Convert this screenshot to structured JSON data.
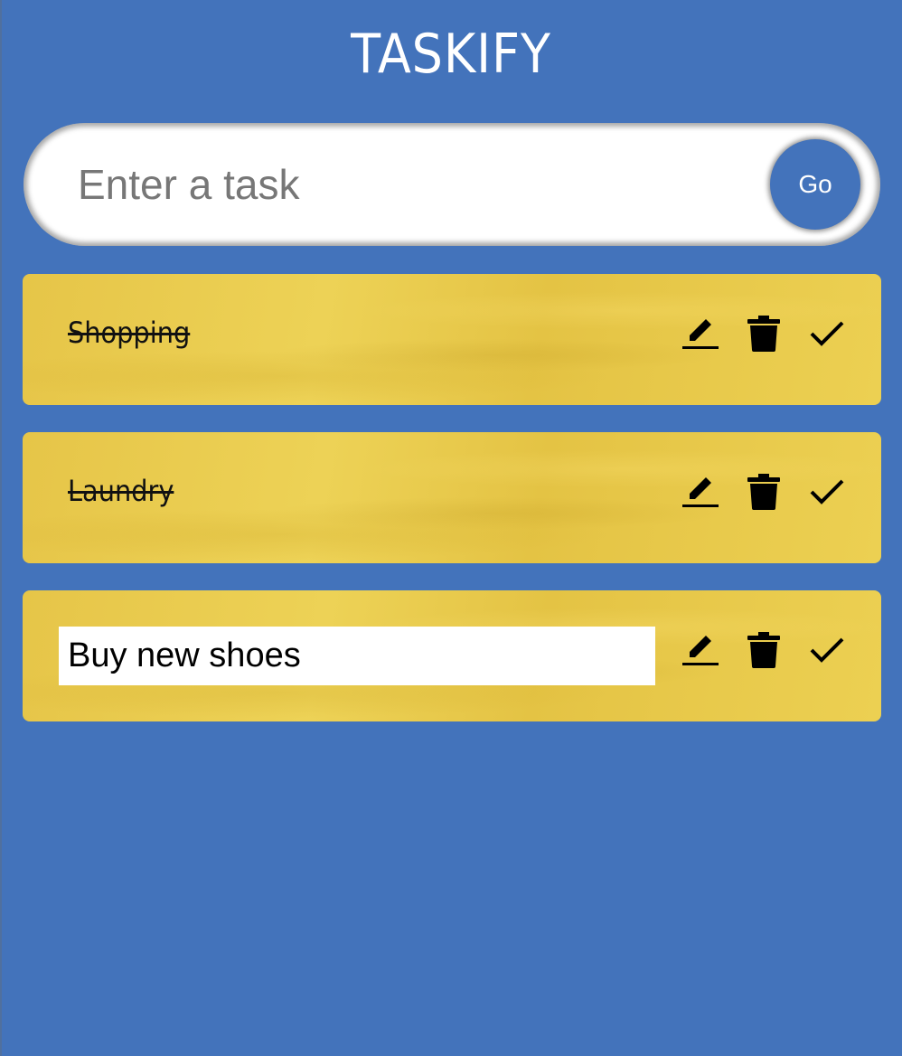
{
  "app": {
    "title": "TASKIFY"
  },
  "input": {
    "placeholder": "Enter a task",
    "value": "",
    "go_label": "Go"
  },
  "tasks": [
    {
      "text": "Shopping",
      "done": true,
      "editing": false
    },
    {
      "text": "Laundry",
      "done": true,
      "editing": false
    },
    {
      "text": "Buy new shoes",
      "done": false,
      "editing": true
    }
  ],
  "icons": {
    "edit": "pencil-icon",
    "delete": "trash-icon",
    "done": "check-icon"
  },
  "colors": {
    "background": "#4373bb",
    "card": "#e8c94a",
    "go_button": "#4373bb"
  }
}
